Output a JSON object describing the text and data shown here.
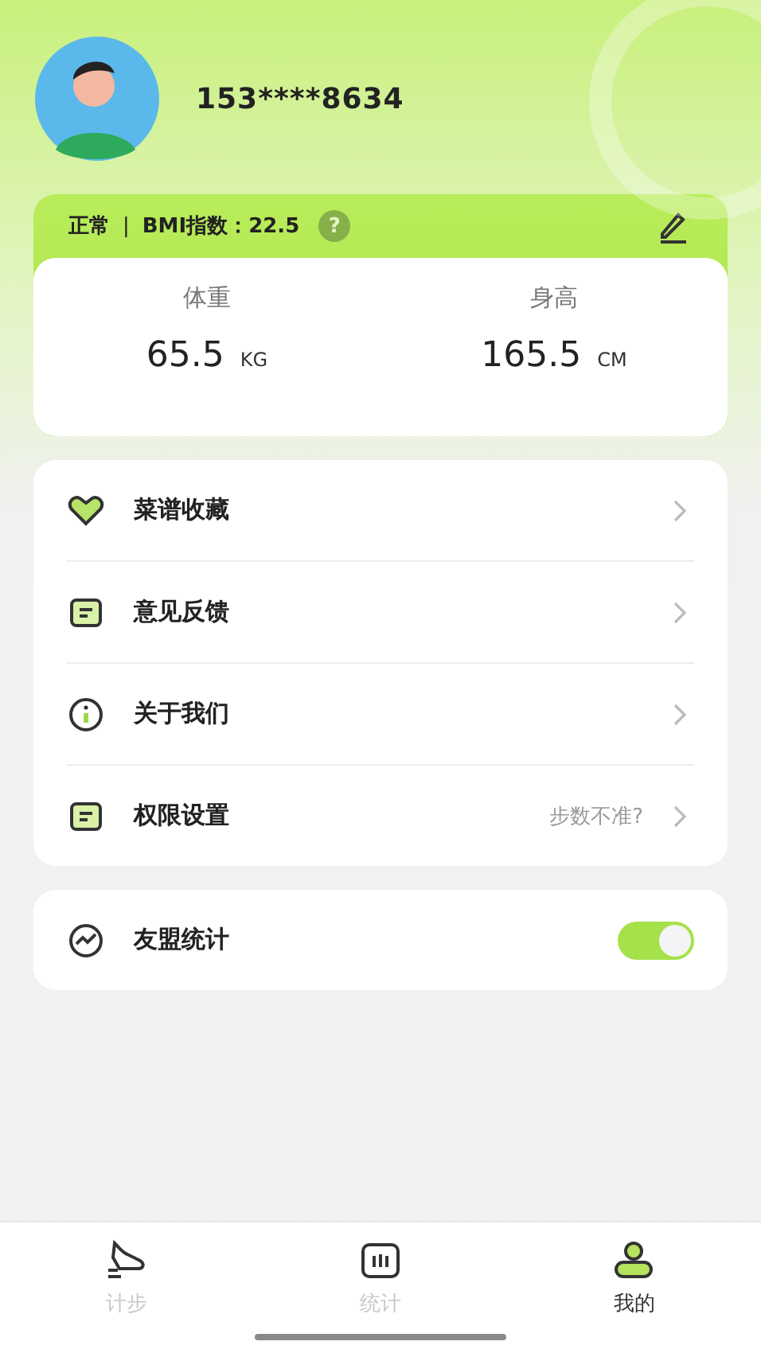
{
  "profile": {
    "phone": "153****8634"
  },
  "bmi": {
    "status": "正常",
    "separator": "|",
    "label": "BMI指数：22.5",
    "help": "?"
  },
  "measures": [
    {
      "label": "体重",
      "value": "65.5",
      "unit": "KG"
    },
    {
      "label": "身高",
      "value": "165.5",
      "unit": "CM"
    }
  ],
  "menu": [
    {
      "kind": "heart",
      "label": "菜谱收藏"
    },
    {
      "kind": "note",
      "label": "意见反馈"
    },
    {
      "kind": "info",
      "label": "关于我们"
    },
    {
      "kind": "note",
      "label": "权限设置",
      "hint": "步数不准?"
    }
  ],
  "toggle_row": {
    "label": "友盟统计",
    "on": true
  },
  "tabs": [
    {
      "kind": "shoe",
      "label": "计步",
      "selected": false
    },
    {
      "kind": "stats",
      "label": "统计",
      "selected": false
    },
    {
      "kind": "person",
      "label": "我的",
      "selected": true
    }
  ]
}
